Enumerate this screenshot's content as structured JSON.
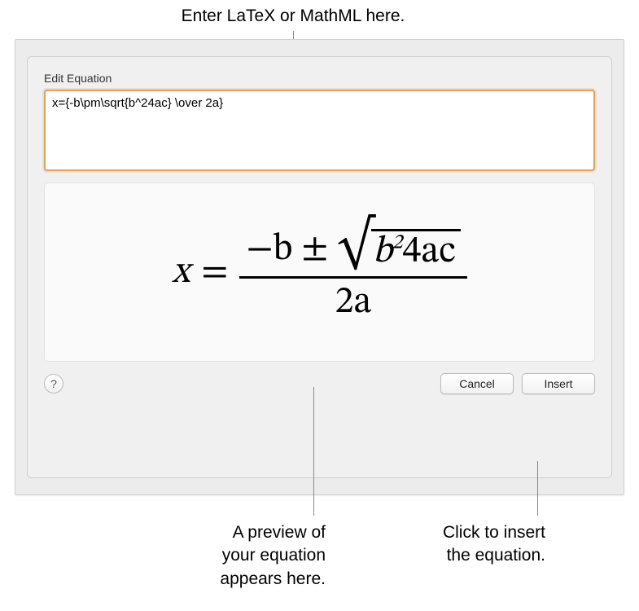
{
  "annotations": {
    "top": "Enter LaTeX or MathML here.",
    "bottom_left": "A preview of\nyour equation\nappears here.",
    "bottom_right": "Click to insert\nthe equation."
  },
  "dialog": {
    "title": "Edit Equation",
    "input_value": "x={-b\\pm\\sqrt{b^24ac} \\over 2a}",
    "help_label": "?",
    "cancel_label": "Cancel",
    "insert_label": "Insert"
  },
  "equation_preview": {
    "lhs": "x",
    "eq": "=",
    "numerator_pre": "−b ±",
    "radicand_base": "b",
    "radicand_exp": "2",
    "radicand_tail": "4ac",
    "denominator": "2a"
  }
}
